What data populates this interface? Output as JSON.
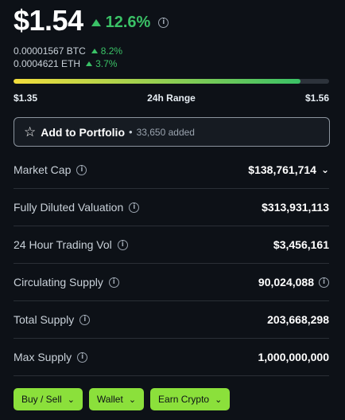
{
  "price": {
    "value": "$1.54",
    "change": "12.6%"
  },
  "conversions": [
    {
      "label": "0.00001567 BTC",
      "change": "8.2%"
    },
    {
      "label": "0.0004621 ETH",
      "change": "3.7%"
    }
  ],
  "range": {
    "low": "$1.35",
    "label": "24h Range",
    "high": "$1.56",
    "position_fraction": 0.91
  },
  "portfolio": {
    "label": "Add to Portfolio",
    "count": "33,650 added"
  },
  "stats": [
    {
      "label": "Market Cap",
      "value": "$138,761,714",
      "has_dropdown": true,
      "value_info": false
    },
    {
      "label": "Fully Diluted Valuation",
      "value": "$313,931,113",
      "has_dropdown": false,
      "value_info": false
    },
    {
      "label": "24 Hour Trading Vol",
      "value": "$3,456,161",
      "has_dropdown": false,
      "value_info": false
    },
    {
      "label": "Circulating Supply",
      "value": "90,024,088",
      "has_dropdown": false,
      "value_info": true
    },
    {
      "label": "Total Supply",
      "value": "203,668,298",
      "has_dropdown": false,
      "value_info": false
    },
    {
      "label": "Max Supply",
      "value": "1,000,000,000",
      "has_dropdown": false,
      "value_info": false
    }
  ],
  "actions": [
    {
      "label": "Buy / Sell"
    },
    {
      "label": "Wallet"
    },
    {
      "label": "Earn Crypto"
    }
  ],
  "colors": {
    "positive": "#3ac166",
    "range_start": "#f2dd3c",
    "range_end": "#3ac166",
    "action_button": "#8be03b"
  },
  "icons": {
    "up": "triangle-up-icon",
    "info": "info-icon",
    "star": "star-outline-icon",
    "chevron": "chevron-down-icon"
  }
}
